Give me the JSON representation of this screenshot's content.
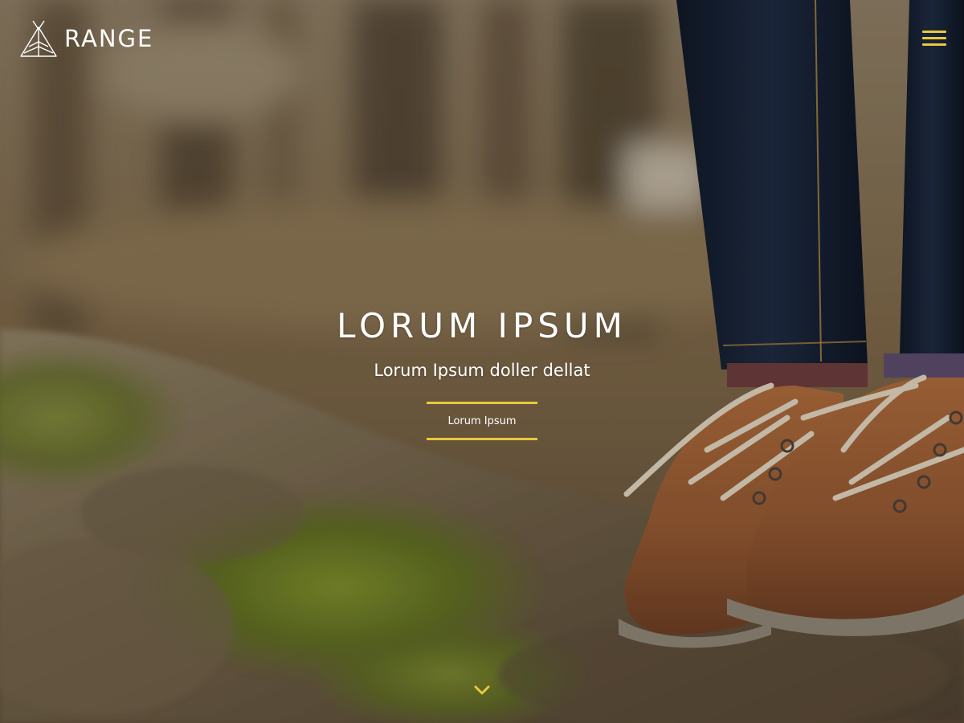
{
  "brand": {
    "name": "RANGE",
    "logo_icon": "teepee-icon"
  },
  "nav": {
    "menu_icon": "hamburger-menu-icon"
  },
  "hero": {
    "title": "LORUM IPSUM",
    "subtitle": "Lorum Ipsum doller dellat",
    "cta_label": "Lorum Ipsum",
    "scroll_icon": "chevron-down-icon"
  },
  "colors": {
    "accent": "#e8c93c",
    "text": "#ffffff"
  }
}
